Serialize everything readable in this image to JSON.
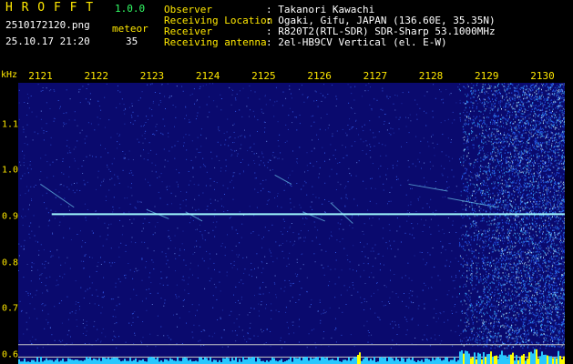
{
  "header": {
    "app_title": "H R O F F T",
    "version": "1.0.0",
    "filename": "2510172120.png",
    "datetime": "25.10.17 21:20",
    "meteor_label": "meteor",
    "meteor_count": "35",
    "observer_label": "Observer",
    "observer_value": ": Takanori Kawachi",
    "location_label": "Receiving Location",
    "location_value": ": Ogaki, Gifu, JAPAN (136.60E, 35.35N)",
    "receiver_label": "Receiver",
    "receiver_value": ": R820T2(RTL-SDR) SDR-Sharp 53.1000MHz",
    "antenna_label": "Receiving antenna",
    "antenna_value": ": 2el-HB9CV Vertical (el. E-W)"
  },
  "axis": {
    "unit": "kHz",
    "x_ticks": [
      "2121",
      "2122",
      "2123",
      "2124",
      "2125",
      "2126",
      "2127",
      "2128",
      "2129",
      "2130"
    ],
    "y_ticks": [
      "1.1",
      "1.0",
      "0.9",
      "0.8",
      "0.7",
      "0.6"
    ]
  },
  "colors": {
    "background": "#0a0a6e",
    "noise": "#3c6cff",
    "carrier": "#9ff8ff",
    "level_bars": "#27c8ff",
    "level_peaks": "#ffff00",
    "label_yellow": "#ffe800"
  },
  "chart_data": {
    "type": "heatmap",
    "x_range": [
      2120.6,
      2130.4
    ],
    "y_range_khz": [
      0.58,
      1.19
    ],
    "carrier_khz": 0.905,
    "carrier_x_start": 2121.2,
    "carrier_x_end": 2130.4,
    "noise_burst_x_start": 2128.5
  }
}
